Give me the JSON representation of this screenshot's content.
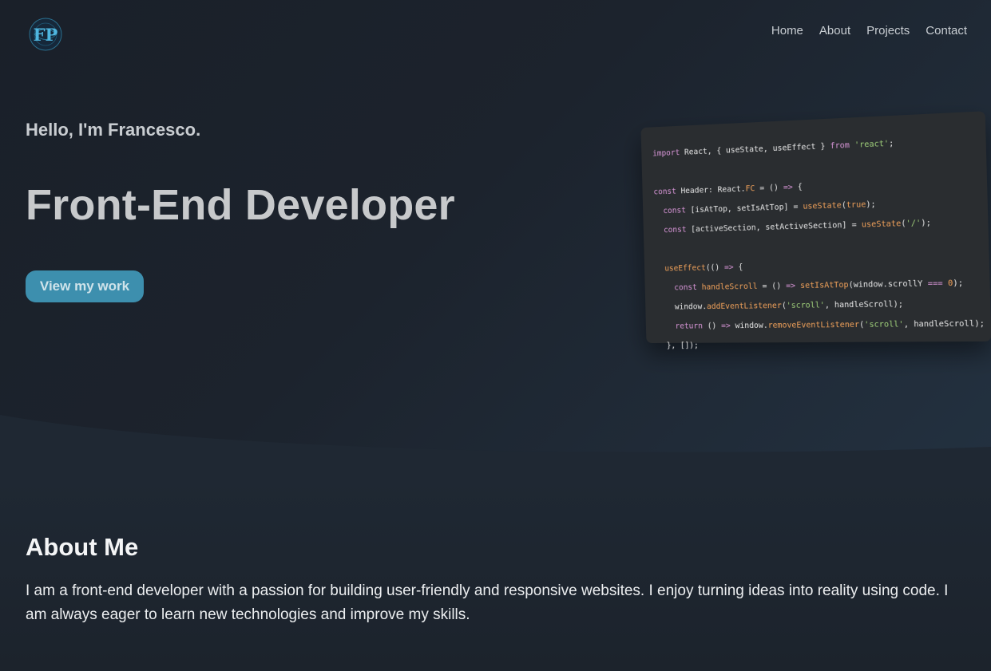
{
  "nav": {
    "logo_text": "FP",
    "items": [
      {
        "label": "Home"
      },
      {
        "label": "About"
      },
      {
        "label": "Projects"
      },
      {
        "label": "Contact"
      }
    ]
  },
  "hero": {
    "greeting": "Hello, I'm Francesco.",
    "role": "Front-End Developer",
    "cta_label": "View my work"
  },
  "code_snippet": {
    "lines": [
      "import React, { useState, useEffect } from 'react';",
      "",
      "const Header: React.FC = () => {",
      "  const [isAtTop, setIsAtTop] = useState(true);",
      "  const [activeSection, setActiveSection] = useState('/');",
      "",
      "  useEffect(() => {",
      "    const handleScroll = () => setIsAtTop(window.scrollY === 0);",
      "    window.addEventListener('scroll', handleScroll);",
      "    return () => window.removeEventListener('scroll', handleScroll);",
      "  }, []);"
    ]
  },
  "about": {
    "heading": "About Me",
    "text": "I am a front-end developer with a passion for building user-friendly and responsive websites. I enjoy turning ideas into reality using code. I am always eager to learn new technologies and improve my skills."
  },
  "colors": {
    "accent": "#3d8fae",
    "background": "#1d2530"
  }
}
